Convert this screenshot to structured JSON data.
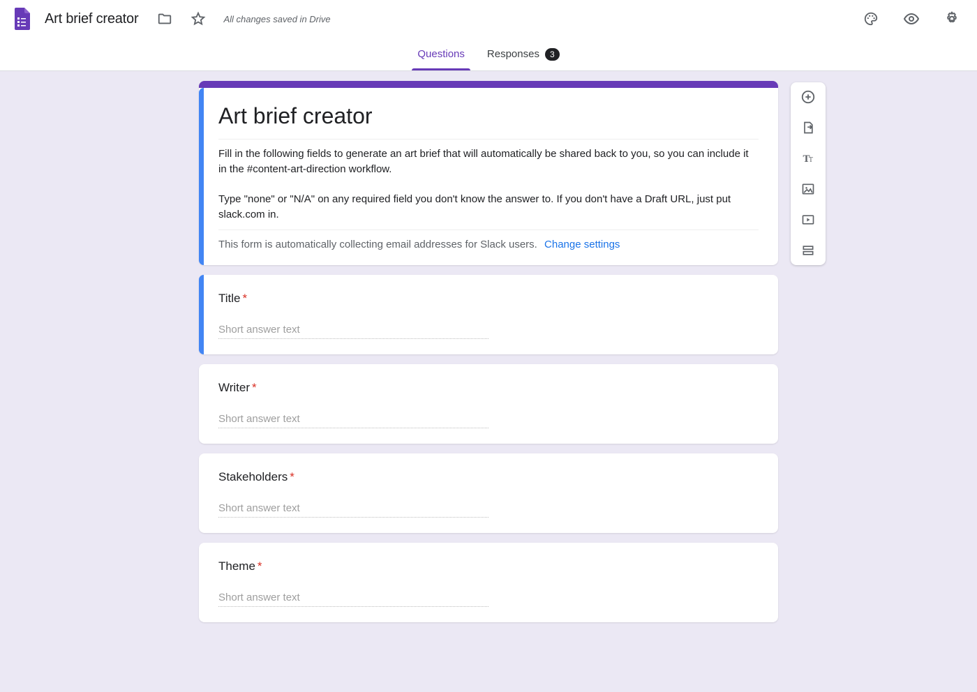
{
  "header": {
    "doc_title": "Art brief creator",
    "save_status": "All changes saved in Drive"
  },
  "tabs": {
    "questions": "Questions",
    "responses": "Responses",
    "responses_count": "3"
  },
  "form": {
    "title": "Art brief creator",
    "description": "Fill in the following fields to generate an art brief that will automatically be shared back to you, so you can include it in the #content-art-direction workflow.\n\nType \"none\" or \"N/A\" on any required field you don't know the answer to. If you don't have a Draft URL, just put slack.com in.",
    "email_notice": "This form is automatically collecting email addresses for Slack users.",
    "email_link": "Change settings"
  },
  "questions": [
    {
      "label": "Title",
      "placeholder": "Short answer text"
    },
    {
      "label": "Writer",
      "placeholder": "Short answer text"
    },
    {
      "label": "Stakeholders",
      "placeholder": "Short answer text"
    },
    {
      "label": "Theme",
      "placeholder": "Short answer text"
    }
  ],
  "required_marker": "*"
}
